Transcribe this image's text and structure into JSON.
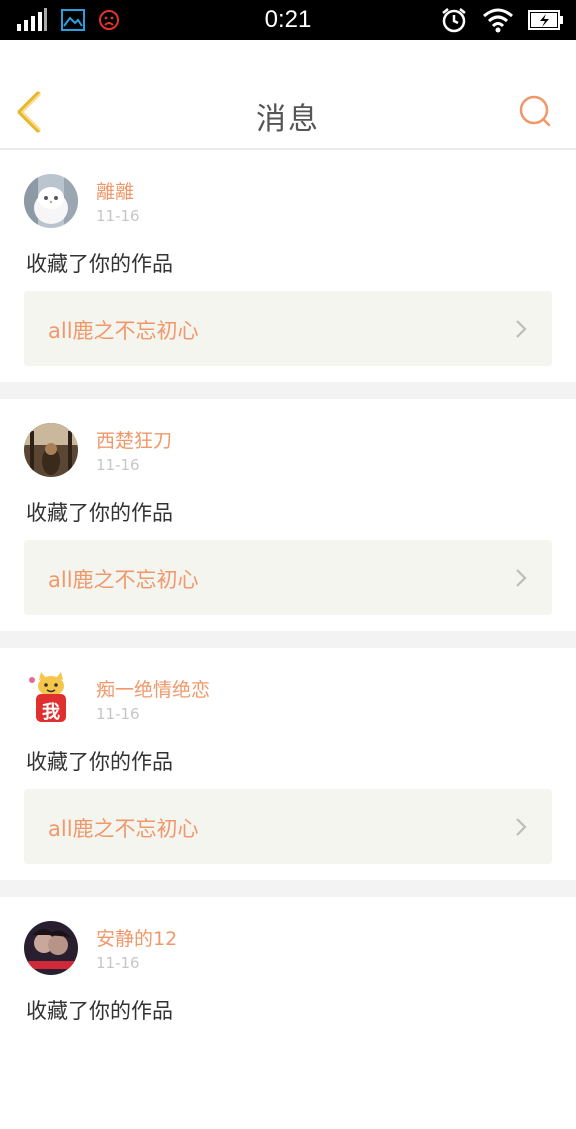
{
  "status_bar": {
    "time": "0:21"
  },
  "header": {
    "title": "消息"
  },
  "colors": {
    "accent": "#f0986a",
    "back_arrow": "#e6b932",
    "work_box_bg": "#f5f5ef",
    "separator": "#f4f3f3"
  },
  "messages": [
    {
      "username": "離離",
      "date": "11-16",
      "action": "收藏了你的作品",
      "work_title": "all鹿之不忘初心",
      "avatar_icon": "white-cat-avatar"
    },
    {
      "username": "西楚狂刀",
      "date": "11-16",
      "action": "收藏了你的作品",
      "work_title": "all鹿之不忘初心",
      "avatar_icon": "dark-scene-avatar"
    },
    {
      "username": "痴一绝情绝恋",
      "date": "11-16",
      "action": "收藏了你的作品",
      "work_title": "all鹿之不忘初心",
      "avatar_icon": "cartoon-cat-avatar",
      "avatar_text": "我"
    },
    {
      "username": "安静的12",
      "date": "11-16",
      "action": "收藏了你的作品",
      "work_title": "",
      "avatar_icon": "couple-photo-avatar"
    }
  ]
}
